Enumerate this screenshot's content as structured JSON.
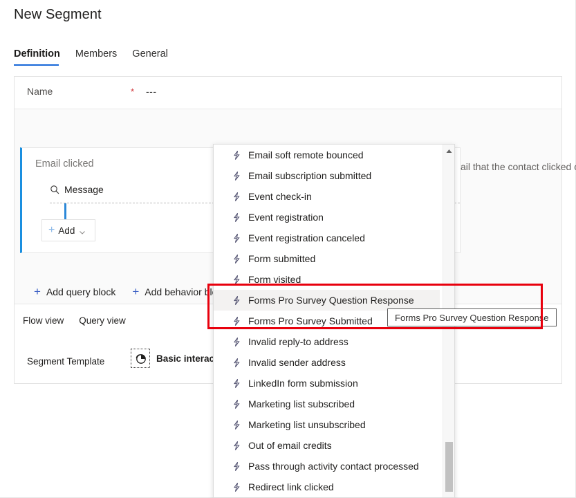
{
  "header": {
    "title": "New Segment",
    "tabs": [
      {
        "label": "Definition",
        "active": true
      },
      {
        "label": "Members",
        "active": false
      },
      {
        "label": "General",
        "active": false
      }
    ]
  },
  "form": {
    "name_label": "Name",
    "required_marker": "*",
    "name_value": "---"
  },
  "query_block": {
    "title": "Email clicked",
    "chevron_icon": "chevron-down-icon",
    "search_icon": "search-icon",
    "message_label": "Message",
    "add_button": {
      "plus_icon": "plus-icon",
      "label": "Add",
      "chevron_icon": "chevron-down-icon"
    },
    "description_fragment": "ail that the contact clicked on"
  },
  "block_links": [
    {
      "icon": "plus-icon",
      "label": "Add query block"
    },
    {
      "icon": "plus-icon",
      "label": "Add behavior block"
    }
  ],
  "footer": {
    "view_links": [
      {
        "label": "Flow view"
      },
      {
        "label": "Query view"
      }
    ],
    "template_label": "Segment Template",
    "template_icon": "pie-chart-icon",
    "template_name": "Basic interaction"
  },
  "dropdown": {
    "scroll_up_icon": "scroll-up-arrow-icon",
    "item_icon": "lightning-bolt-icon",
    "items": [
      {
        "label": "Email soft remote bounced",
        "selected": false
      },
      {
        "label": "Email subscription submitted",
        "selected": false
      },
      {
        "label": "Event check-in",
        "selected": false
      },
      {
        "label": "Event registration",
        "selected": false
      },
      {
        "label": "Event registration canceled",
        "selected": false
      },
      {
        "label": "Form submitted",
        "selected": false
      },
      {
        "label": "Form visited",
        "selected": false
      },
      {
        "label": "Forms Pro Survey Question Response",
        "selected": true
      },
      {
        "label": "Forms Pro Survey Submitted",
        "selected": false
      },
      {
        "label": "Invalid reply-to address",
        "selected": false
      },
      {
        "label": "Invalid sender address",
        "selected": false
      },
      {
        "label": "LinkedIn form submission",
        "selected": false
      },
      {
        "label": "Marketing list subscribed",
        "selected": false
      },
      {
        "label": "Marketing list unsubscribed",
        "selected": false
      },
      {
        "label": "Out of email credits",
        "selected": false
      },
      {
        "label": "Pass through activity contact processed",
        "selected": false
      },
      {
        "label": "Redirect link clicked",
        "selected": false
      }
    ]
  },
  "tooltip": {
    "text": "Forms Pro Survey Question Response"
  },
  "colors": {
    "accent_blue": "#1767d8",
    "block_accent": "#1a8fe0",
    "annotation_red": "#e8000d",
    "required_red": "#d13438"
  }
}
